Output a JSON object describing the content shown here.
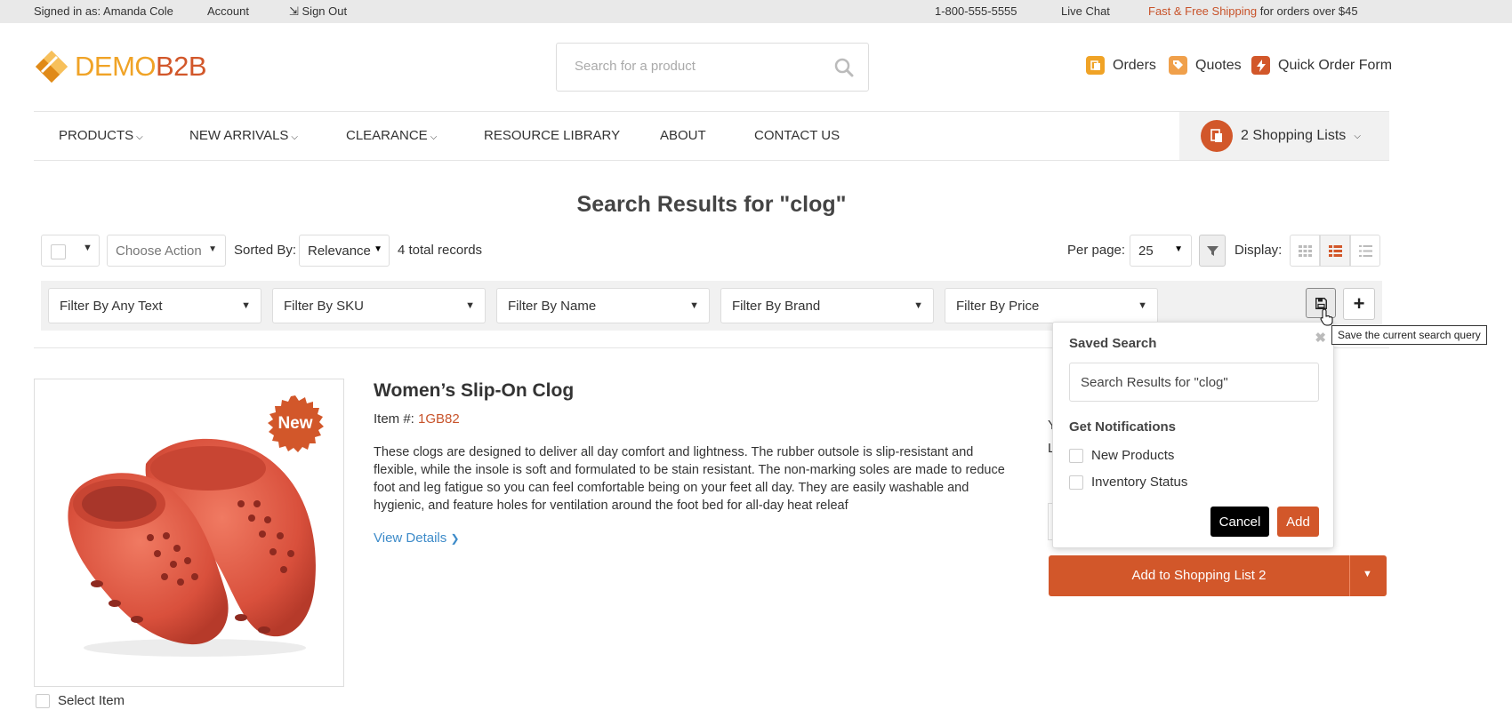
{
  "topbar": {
    "signed_in": "Signed in as: Amanda Cole",
    "account": "Account",
    "sign_out": "Sign Out",
    "phone": "1-800-555-5555",
    "live_chat": "Live Chat",
    "shipping_link": "Fast & Free Shipping",
    "shipping_rest": " for orders over $45"
  },
  "header": {
    "logo_part1": "DEMO",
    "logo_part2": "B2B",
    "search_placeholder": "Search for a product",
    "orders": "Orders",
    "quotes": "Quotes",
    "quick_order": "Quick Order Form"
  },
  "nav": {
    "items": [
      "PRODUCTS",
      "NEW ARRIVALS",
      "CLEARANCE",
      "RESOURCE LIBRARY",
      "ABOUT",
      "CONTACT US"
    ],
    "shopping_lists": "2 Shopping Lists"
  },
  "page_title": "Search Results for \"clog\"",
  "toolbar": {
    "choose_action": "Choose Action",
    "sorted_by_label": "Sorted By:",
    "sorted_by_value": "Relevance",
    "total": "4 total records",
    "per_page_label": "Per page:",
    "per_page_value": "25",
    "display_label": "Display:"
  },
  "filters": [
    "Filter By Any Text",
    "Filter By SKU",
    "Filter By Name",
    "Filter By Brand",
    "Filter By Price"
  ],
  "tooltip": "Save the current search query",
  "product": {
    "badge": "New",
    "title": "Women’s Slip-On Clog",
    "item_label": "Item #: ",
    "sku": "1GB82",
    "description": "These clogs are designed to deliver all day comfort and lightness. The rubber outsole is slip-resistant and flexible, while the insole is soft and formulated to be stain resistant. The non-marking soles are made to reduce foot and leg fatigue so you can feel comfortable being on your feet all day. They are easily washable and hygienic, and feature holes for ventilation around the foot bed for all-day heat releaf",
    "view_details": "View Details",
    "select_item": "Select Item",
    "right_col_y": "Y",
    "right_col_l": "L",
    "add_button": "Add to Shopping List 2"
  },
  "popover": {
    "title": "Saved Search",
    "input_value": "Search Results for \"clog\"",
    "notifications_label": "Get Notifications",
    "option_new_products": "New Products",
    "option_inventory": "Inventory Status",
    "cancel": "Cancel",
    "add": "Add"
  },
  "colors": {
    "brand_orange": "#d2572a",
    "logo_yellow": "#f0a326",
    "link_blue": "#3d8bc9"
  }
}
